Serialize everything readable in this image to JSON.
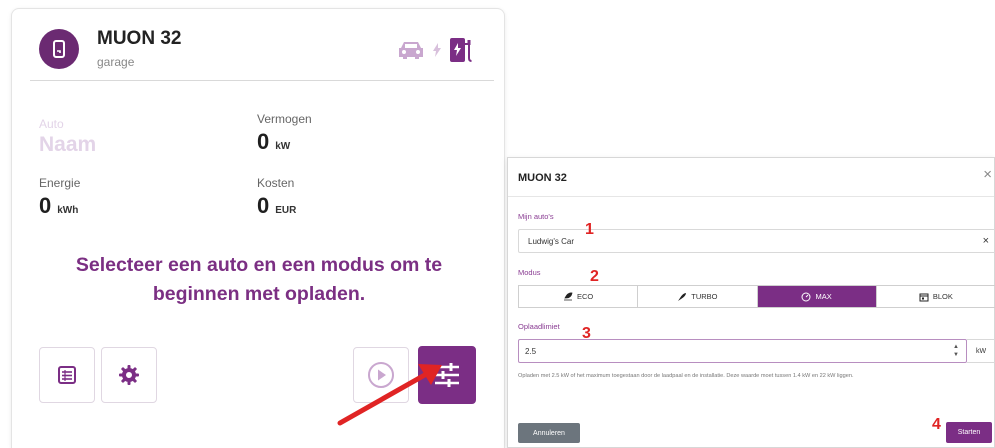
{
  "card": {
    "title": "MUON 32",
    "subtitle": "garage",
    "head_icons": [
      "car-icon",
      "bolt-icon",
      "charger-icon"
    ],
    "auto_label": "Auto",
    "auto_value": "Naam",
    "power_label": "Vermogen",
    "power_value": "0",
    "power_unit": "kW",
    "energy_label": "Energie",
    "energy_value": "0",
    "energy_unit": "kWh",
    "cost_label": "Kosten",
    "cost_value": "0",
    "cost_unit": "EUR",
    "prompt_line1": "Selecteer een auto en een modus om te",
    "prompt_line2": "beginnen met opladen.",
    "buttons": [
      "list-icon",
      "gear-icon",
      "play-icon",
      "sliders-icon"
    ]
  },
  "modal": {
    "title": "MUON 32",
    "close": "×",
    "cars_label": "Mijn auto's",
    "car_value": "Ludwig's Car",
    "car_clear": "×",
    "mode_label": "Modus",
    "modes": [
      {
        "label": "ECO",
        "icon": "leaf-icon"
      },
      {
        "label": "TURBO",
        "icon": "rocket-icon"
      },
      {
        "label": "MAX",
        "icon": "gauge-icon"
      },
      {
        "label": "BLOK",
        "icon": "calendar-icon"
      }
    ],
    "active_mode": "MAX",
    "limit_label": "Oplaadlimiet",
    "limit_value": "2.5",
    "limit_unit": "kW",
    "help_text": "Opladen met 2.5 kW of het maximum toegestaan door de laadpaal en de installatie. Deze waarde moet tussen 1.4 kW en 22 kW liggen.",
    "cancel_label": "Annuleren",
    "start_label": "Starten"
  },
  "annotations": {
    "step1": "1",
    "step2": "2",
    "step3": "3",
    "step4": "4",
    "color": "#e02424"
  },
  "colors": {
    "accent": "#7b2e85",
    "prompt": "#7b2f83",
    "muted": "#e3d4e8"
  }
}
